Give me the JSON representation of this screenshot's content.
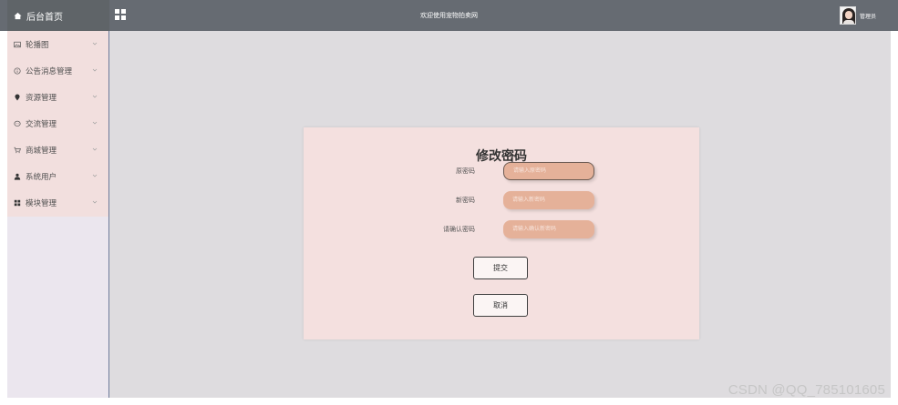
{
  "header": {
    "home_label": "后台首页",
    "site_title": "欢迎使用宠物拍卖网",
    "user_name": "管理员"
  },
  "sidebar": {
    "items": [
      {
        "label": "轮播图",
        "icon": "image-icon"
      },
      {
        "label": "公告消息管理",
        "icon": "info-circle-icon"
      },
      {
        "label": "资源管理",
        "icon": "location-pin-icon"
      },
      {
        "label": "交流管理",
        "icon": "chat-bubble-icon"
      },
      {
        "label": "商城管理",
        "icon": "cart-icon"
      },
      {
        "label": "系统用户",
        "icon": "user-icon"
      },
      {
        "label": "模块管理",
        "icon": "grid-icon"
      }
    ]
  },
  "form": {
    "title": "修改密码",
    "fields": [
      {
        "label": "原密码",
        "placeholder": "请输入原密码"
      },
      {
        "label": "新密码",
        "placeholder": "请输入新密码"
      },
      {
        "label": "请确认密码",
        "placeholder": "请输入确认新密码"
      }
    ],
    "submit_label": "提交",
    "cancel_label": "取消"
  },
  "watermark": "CSDN @QQ_785101605",
  "colors": {
    "topbar": "#666b72",
    "sidebar_menu": "#f2dfde",
    "main_bg": "#dedcdf",
    "card_bg": "#f4e0df",
    "input_bg": "#e5b199"
  }
}
